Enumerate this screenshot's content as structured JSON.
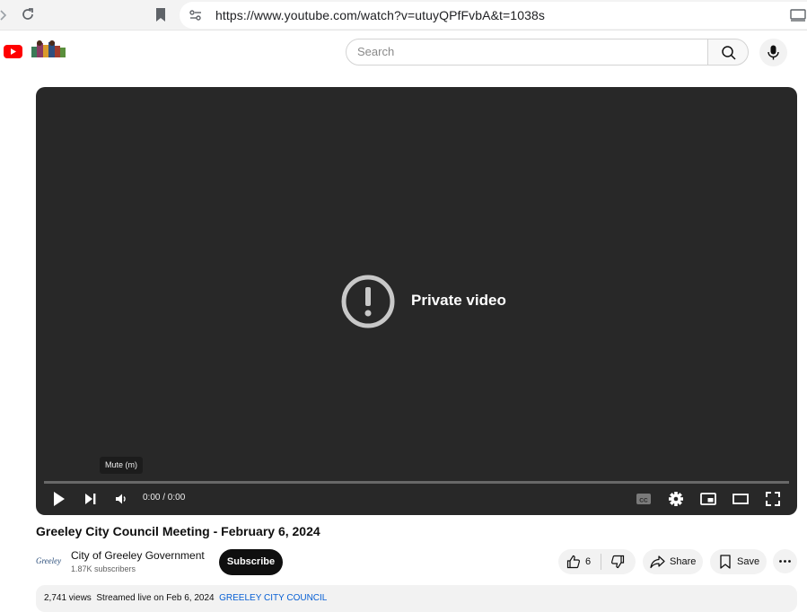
{
  "browser": {
    "url": "https://www.youtube.com/watch?v=utuyQPfFvbA&t=1038s"
  },
  "masthead": {
    "search_placeholder": "Search"
  },
  "player": {
    "status_text": "Private video",
    "tooltip": "Mute (m)",
    "time": "0:00 / 0:00",
    "progress": 0
  },
  "video": {
    "title": "Greeley City Council Meeting - February 6, 2024",
    "channel": {
      "name": "City of Greeley Government",
      "subscribers": "1.87K subscribers",
      "avatar_text": "Greeley"
    },
    "subscribe_label": "Subscribe",
    "likes": "6",
    "share_label": "Share",
    "save_label": "Save"
  },
  "description": {
    "views": "2,741 views",
    "streamed": "Streamed live on Feb 6, 2024",
    "tag": "GREELEY CITY COUNCIL"
  },
  "colors": {
    "player_bg": "#282828",
    "brand_red": "#ff0000",
    "link_blue": "#065fd4"
  }
}
